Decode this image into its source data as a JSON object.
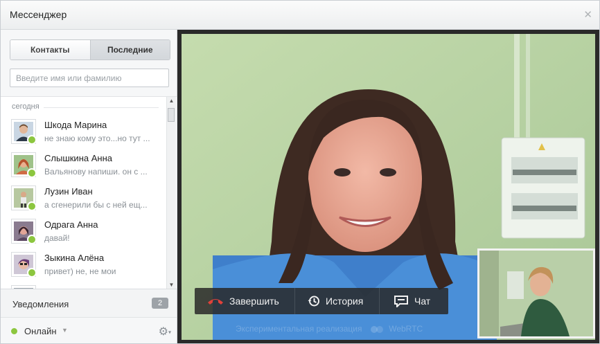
{
  "window": {
    "title": "Мессенджер"
  },
  "tabs": [
    {
      "label": "Контакты",
      "active": false
    },
    {
      "label": "Последние",
      "active": true
    }
  ],
  "search": {
    "placeholder": "Введите имя или фамилию",
    "value": ""
  },
  "section": {
    "label": "сегодня"
  },
  "contacts": [
    {
      "name": "Шкода Марина",
      "message": "не знаю кому это...но тут ...",
      "status": "online"
    },
    {
      "name": "Слышкина Анна",
      "message": "Вальянову напиши. он с ...",
      "status": "online"
    },
    {
      "name": "Лузин Иван",
      "message": "а сгенерили бы с ней ещ...",
      "status": "online"
    },
    {
      "name": "Одрага Анна",
      "message": "давай!",
      "status": "online"
    },
    {
      "name": "Зыкина Алёна",
      "message": "привет) не, не мои",
      "status": "online"
    }
  ],
  "notifications": {
    "label": "Уведомления",
    "count": "2"
  },
  "status": {
    "label": "Онлайн",
    "color": "#8cc63f"
  },
  "call_controls": {
    "end_label": "Завершить",
    "history_label": "История",
    "chat_label": "Чат"
  },
  "footer": {
    "note": "Экспериментальная реализация",
    "tech": "WebRTC"
  },
  "colors": {
    "online": "#8cc63f",
    "end_call": "#e0413a",
    "panel_bg": "#2a2a2a"
  },
  "icons": {
    "close": "close-icon",
    "end_call": "phone-hangup-icon",
    "history": "history-icon",
    "chat": "chat-icon",
    "settings": "gear-icon",
    "webrtc": "webrtc-logo-icon"
  }
}
